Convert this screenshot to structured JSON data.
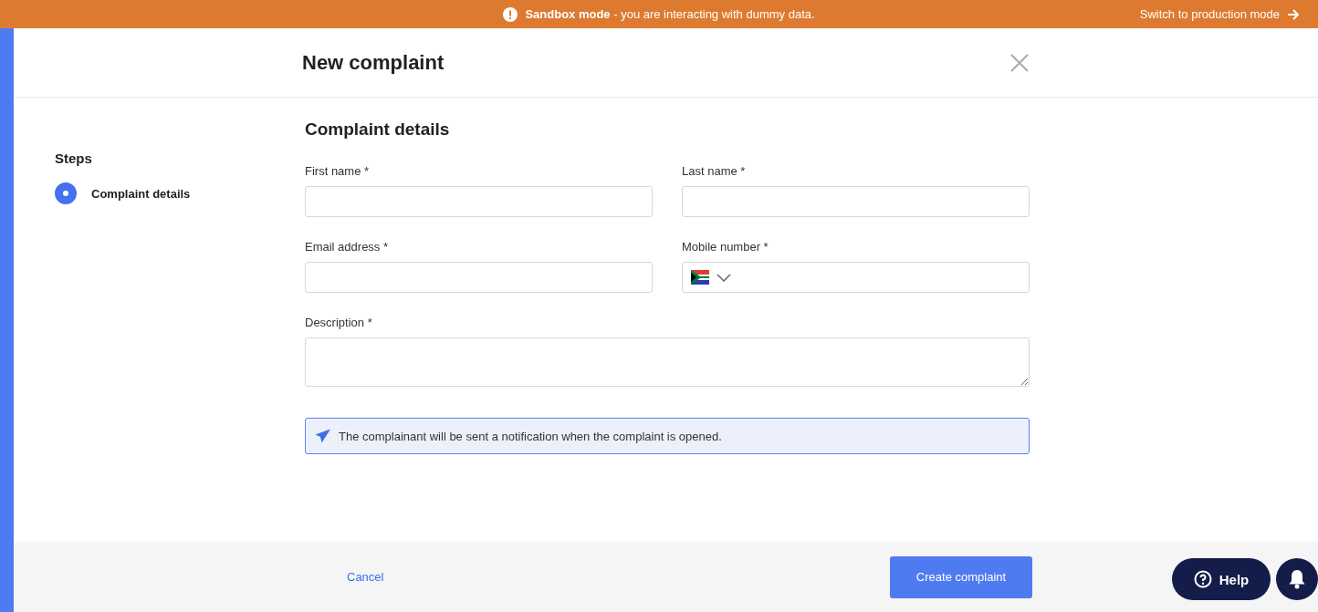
{
  "banner": {
    "message": "**Sandbox mode** - you are interacting with dummy data.",
    "link": "Switch to production mode"
  },
  "dialog": {
    "title": "New complaint"
  },
  "steps": {
    "heading": "Steps",
    "items": [
      {
        "label": "Complaint details",
        "selected": true
      }
    ]
  },
  "form": {
    "title": "Complaint details",
    "fields": [
      {
        "label": "First name *",
        "kind": "text"
      },
      {
        "label": "Last name *",
        "kind": "text"
      },
      {
        "label": "Email address *",
        "kind": "text"
      },
      {
        "label": "Mobile number *",
        "kind": "phone"
      },
      {
        "label": "Description *",
        "kind": "textarea"
      }
    ],
    "notice": "The complainant will be sent a notification when the complaint is opened."
  },
  "footer": {
    "cancel": "Cancel",
    "submit": "Create complaint"
  },
  "help": {
    "label": "Help"
  }
}
